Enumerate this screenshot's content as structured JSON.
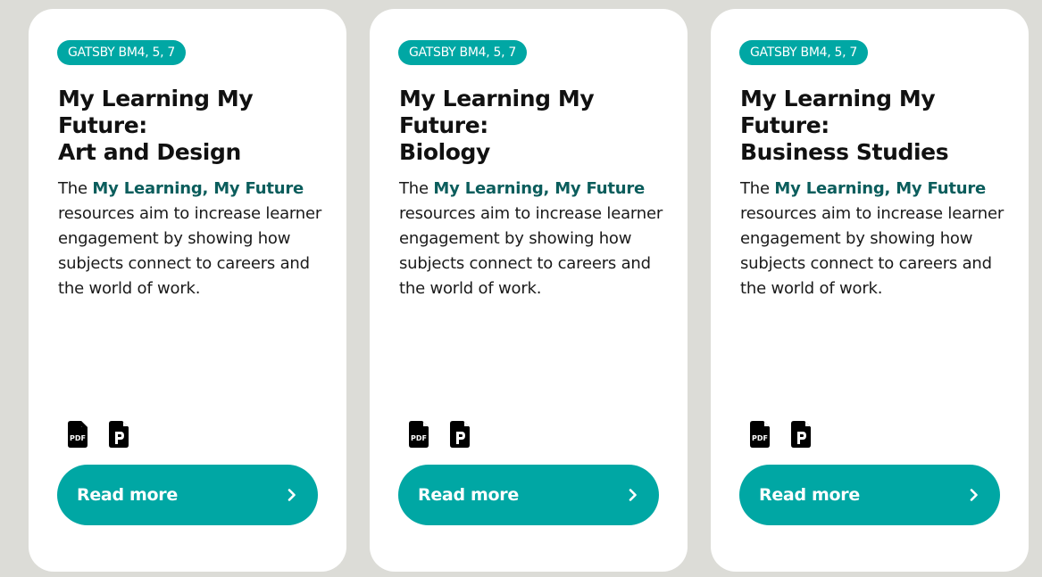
{
  "cards": [
    {
      "badge": "GATSBY BM4, 5, 7",
      "title_line1": "My Learning My Future:",
      "title_line2": "Art and Design",
      "desc_prefix": "The ",
      "desc_link": "My Learning, My Future",
      "desc_suffix": " resources aim to increase learner engagement by showing how subjects connect to careers and the world of work.",
      "icons": [
        "pdf-file-icon",
        "powerpoint-file-icon"
      ],
      "button_label": "Read more",
      "button_icon": "chevron-right-icon"
    },
    {
      "badge": "GATSBY BM4, 5, 7",
      "title_line1": "My Learning My Future:",
      "title_line2": "Biology",
      "desc_prefix": "The ",
      "desc_link": "My Learning, My Future",
      "desc_suffix": " resources aim to increase learner engagement by showing how subjects connect to careers and the world of work.",
      "icons": [
        "pdf-file-icon",
        "powerpoint-file-icon"
      ],
      "button_label": "Read more",
      "button_icon": "chevron-right-icon"
    },
    {
      "badge": "GATSBY BM4, 5, 7",
      "title_line1": "My Learning My Future:",
      "title_line2": "Business Studies",
      "desc_prefix": "The ",
      "desc_link": "My Learning, My Future",
      "desc_suffix": " resources aim to increase learner engagement by showing how subjects connect to careers and the world of work.",
      "icons": [
        "pdf-file-icon",
        "powerpoint-file-icon"
      ],
      "button_label": "Read more",
      "button_icon": "chevron-right-icon"
    }
  ],
  "colors": {
    "page_background": "#dcdcd7",
    "card_background": "#ffffff",
    "accent": "#00a7a4",
    "link": "#0b5d5c",
    "text": "#111111"
  }
}
